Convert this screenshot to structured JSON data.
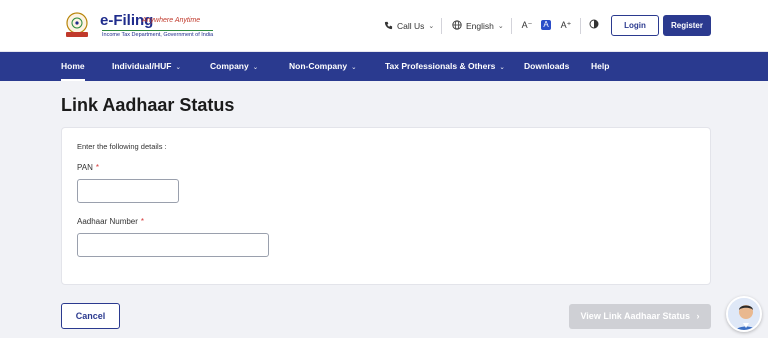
{
  "header": {
    "brand_main": "e-Filing",
    "brand_tagline": "Anywhere Anytime",
    "brand_sub": "Income Tax Department, Government of India",
    "call_us": "Call Us",
    "language": "English",
    "font_decrease": "A⁻",
    "font_normal": "A",
    "font_increase": "A⁺",
    "contrast_icon": "contrast-icon",
    "login_label": "Login",
    "register_label": "Register"
  },
  "nav": {
    "items": [
      {
        "label": "Home",
        "active": true,
        "dropdown": false
      },
      {
        "label": "Individual/HUF",
        "active": false,
        "dropdown": true
      },
      {
        "label": "Company",
        "active": false,
        "dropdown": true
      },
      {
        "label": "Non-Company",
        "active": false,
        "dropdown": true
      },
      {
        "label": "Tax Professionals & Others",
        "active": false,
        "dropdown": true
      },
      {
        "label": "Downloads",
        "active": false,
        "dropdown": false
      },
      {
        "label": "Help",
        "active": false,
        "dropdown": false
      }
    ]
  },
  "main": {
    "title": "Link Aadhaar Status",
    "instructions": "Enter the following details :",
    "pan": {
      "label": "PAN",
      "required_mark": "*",
      "value": "",
      "placeholder": ""
    },
    "aadhaar": {
      "label": "Aadhaar Number",
      "required_mark": "*",
      "value": "",
      "placeholder": ""
    }
  },
  "actions": {
    "cancel_label": "Cancel",
    "view_status_label": "View Link Aadhaar Status",
    "view_status_chevron": "›"
  },
  "colors": {
    "primary": "#2a3a8f",
    "disabled": "#cfd0d5",
    "required": "#d63a3a",
    "background": "#f1f2f6"
  }
}
